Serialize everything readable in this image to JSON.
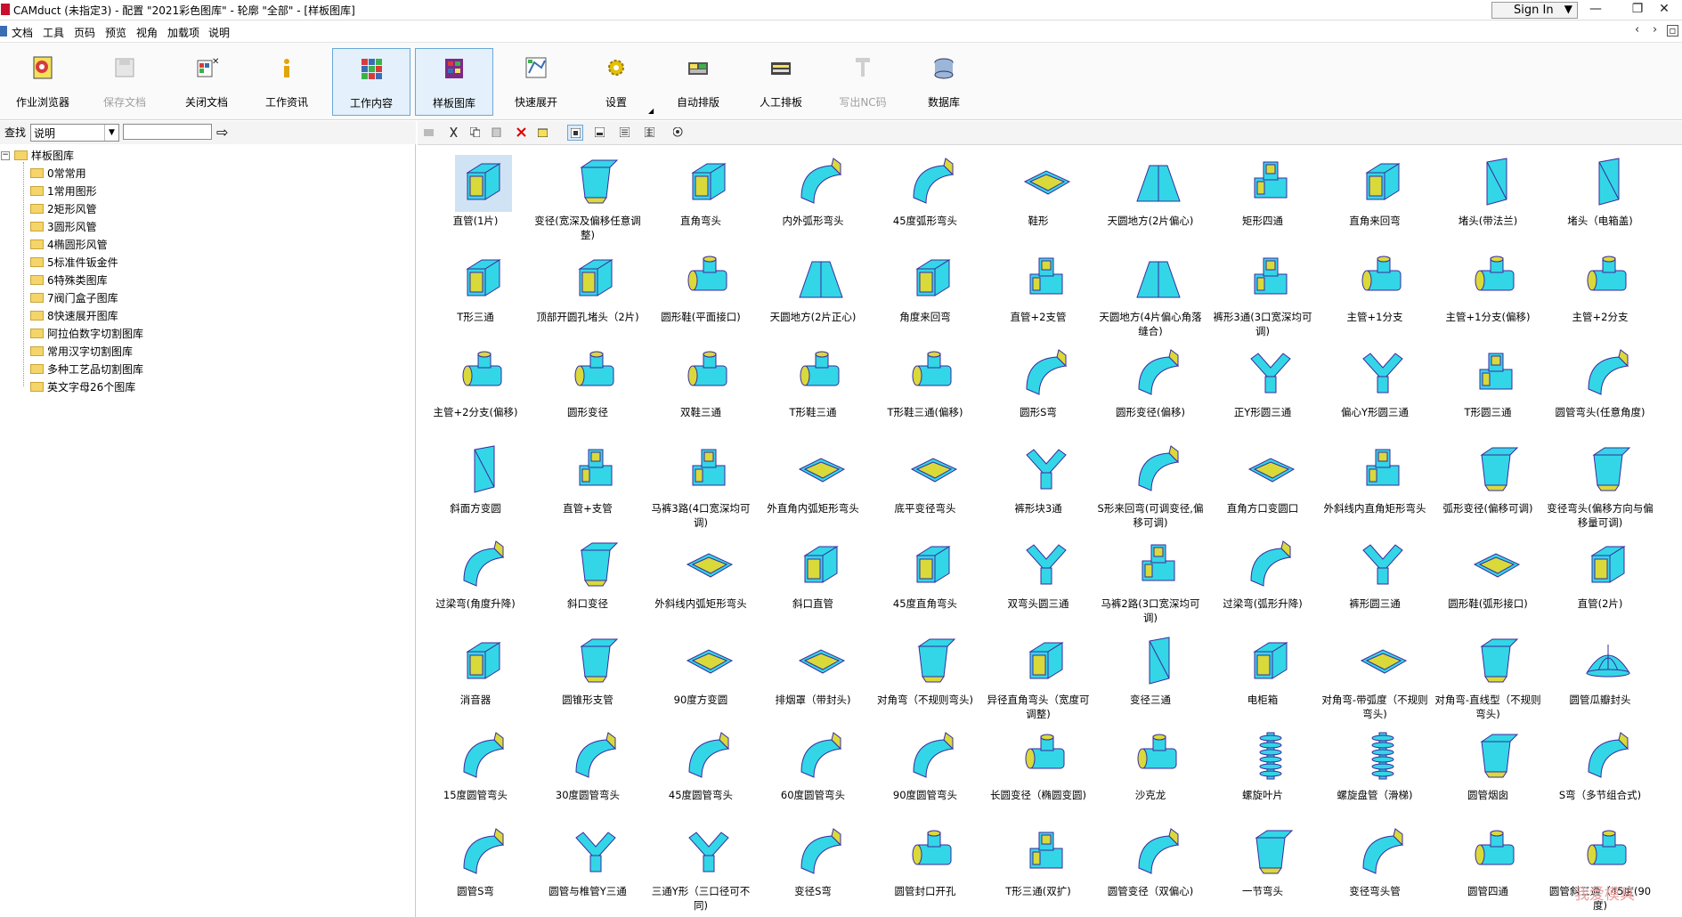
{
  "window": {
    "title": "CAMduct (未指定3) - 配置 \"2021彩色图库\" - 轮廓 \"全部\" - [样板图库]",
    "signin_label": "Sign In",
    "controls": [
      "—",
      "❐",
      "✕"
    ]
  },
  "menu": {
    "items": [
      "文档",
      "工具",
      "页码",
      "预览",
      "视角",
      "加载项",
      "说明"
    ]
  },
  "toolbar": {
    "buttons": [
      {
        "label": "作业浏览器",
        "icon": "job-browser-icon",
        "state": "normal"
      },
      {
        "label": "保存文档",
        "icon": "save-icon",
        "state": "disabled"
      },
      {
        "label": "关闭文档",
        "icon": "close-doc-icon",
        "state": "normal"
      },
      {
        "label": "工作资讯",
        "icon": "info-icon",
        "state": "normal"
      },
      {
        "label": "工作内容",
        "icon": "work-content-icon",
        "state": "active"
      },
      {
        "label": "样板图库",
        "icon": "pattern-library-icon",
        "state": "active"
      },
      {
        "label": "快速展开",
        "icon": "quick-unfold-icon",
        "state": "normal"
      },
      {
        "label": "设置",
        "icon": "settings-icon",
        "state": "normal"
      },
      {
        "label": "自动排版",
        "icon": "auto-nest-icon",
        "state": "normal"
      },
      {
        "label": "人工排板",
        "icon": "manual-nest-icon",
        "state": "normal"
      },
      {
        "label": "写出NC码",
        "icon": "nc-code-icon",
        "state": "disabled"
      },
      {
        "label": "数据库",
        "icon": "database-icon",
        "state": "normal"
      }
    ]
  },
  "find": {
    "label": "查找",
    "field_value": "说明",
    "search_value": ""
  },
  "tree": {
    "root": "样板图库",
    "folders": [
      "0常常用",
      "1常用图形",
      "2矩形风管",
      "3圆形风管",
      "4椭圆形风管",
      "5标准件钣金件",
      "6特殊类图库",
      "7阀门盒子图库",
      "8快速展开图库",
      "阿拉伯数字切割图库",
      "常用汉字切割图库",
      "多种工艺品切割图库",
      "英文字母26个图库"
    ]
  },
  "itembar": {
    "icons": [
      "folder-up-icon",
      "cut-icon",
      "copy-icon",
      "paste-icon",
      "delete-icon",
      "properties-icon",
      "large-icons-view-icon",
      "small-icons-view-icon",
      "list-view-icon",
      "details-view-icon",
      "preview-icon"
    ]
  },
  "items": [
    {
      "label": "直管(1片)",
      "shape": "rect"
    },
    {
      "label": "变径(宽深及偏移任意调整)",
      "shape": "taper"
    },
    {
      "label": "直角弯头",
      "shape": "rect"
    },
    {
      "label": "内外弧形弯头",
      "shape": "elbow"
    },
    {
      "label": "45度弧形弯头",
      "shape": "elbow"
    },
    {
      "label": "鞋形",
      "shape": "flat"
    },
    {
      "label": "天圆地方(2片偏心)",
      "shape": "trap"
    },
    {
      "label": "矩形四通",
      "shape": "cross"
    },
    {
      "label": "直角来回弯",
      "shape": "rect"
    },
    {
      "label": "堵头(带法兰)",
      "shape": "plate"
    },
    {
      "label": "堵头（电箱盖)",
      "shape": "plate"
    },
    {
      "label": "T形三通",
      "shape": "rect"
    },
    {
      "label": "顶部开圆孔堵头（2片)",
      "shape": "rect"
    },
    {
      "label": "圆形鞋(平面接口)",
      "shape": "round"
    },
    {
      "label": "天圆地方(2片正心)",
      "shape": "trap"
    },
    {
      "label": "角度来回弯",
      "shape": "rect"
    },
    {
      "label": "直管+2支管",
      "shape": "cross"
    },
    {
      "label": "天圆地方(4片偏心角落缝合)",
      "shape": "trap"
    },
    {
      "label": "裤形3通(3口宽深均可调)",
      "shape": "cross"
    },
    {
      "label": "主管+1分支",
      "shape": "round"
    },
    {
      "label": "主管+1分支(偏移)",
      "shape": "round"
    },
    {
      "label": "主管+2分支",
      "shape": "round"
    },
    {
      "label": "主管+2分支(偏移)",
      "shape": "round"
    },
    {
      "label": "圆形变径",
      "shape": "round"
    },
    {
      "label": "双鞋三通",
      "shape": "round"
    },
    {
      "label": "T形鞋三通",
      "shape": "round"
    },
    {
      "label": "T形鞋三通(偏移)",
      "shape": "round"
    },
    {
      "label": "圆形S弯",
      "shape": "elbow"
    },
    {
      "label": "圆形变径(偏移)",
      "shape": "elbow"
    },
    {
      "label": "正Y形圆三通",
      "shape": "wye"
    },
    {
      "label": "偏心Y形圆三通",
      "shape": "wye"
    },
    {
      "label": "T形圆三通",
      "shape": "cross"
    },
    {
      "label": "圆管弯头(任意角度)",
      "shape": "elbow"
    },
    {
      "label": "斜面方变圆",
      "shape": "plate"
    },
    {
      "label": "直管+支管",
      "shape": "cross"
    },
    {
      "label": "马裤3路(4口宽深均可调)",
      "shape": "cross"
    },
    {
      "label": "外直角内弧矩形弯头",
      "shape": "flat"
    },
    {
      "label": "底平变径弯头",
      "shape": "flat"
    },
    {
      "label": "裤形块3通",
      "shape": "wye"
    },
    {
      "label": "S形来回弯(可调变径,偏移可调)",
      "shape": "elbow"
    },
    {
      "label": "直角方口变圆口",
      "shape": "flat"
    },
    {
      "label": "外斜线内直角矩形弯头",
      "shape": "cross"
    },
    {
      "label": "弧形变径(偏移可调)",
      "shape": "taper"
    },
    {
      "label": "变径弯头(偏移方向与偏移量可调)",
      "shape": "taper"
    },
    {
      "label": "过梁弯(角度升降)",
      "shape": "elbow"
    },
    {
      "label": "斜口变径",
      "shape": "taper"
    },
    {
      "label": "外斜线内弧矩形弯头",
      "shape": "flat"
    },
    {
      "label": "斜口直管",
      "shape": "rect"
    },
    {
      "label": "45度直角弯头",
      "shape": "rect"
    },
    {
      "label": "双弯头圆三通",
      "shape": "wye"
    },
    {
      "label": "马裤2路(3口宽深均可调)",
      "shape": "cross"
    },
    {
      "label": "过梁弯(弧形升降)",
      "shape": "elbow"
    },
    {
      "label": "裤形圆三通",
      "shape": "wye"
    },
    {
      "label": "圆形鞋(弧形接口)",
      "shape": "flat"
    },
    {
      "label": "直管(2片)",
      "shape": "rect"
    },
    {
      "label": "消音器",
      "shape": "rect"
    },
    {
      "label": "圆锥形支管",
      "shape": "taper"
    },
    {
      "label": "90度方变圆",
      "shape": "flat"
    },
    {
      "label": "排烟罩（带封头)",
      "shape": "flat"
    },
    {
      "label": "对角弯（不规则弯头)",
      "shape": "taper"
    },
    {
      "label": "异径直角弯头（宽度可调整)",
      "shape": "rect"
    },
    {
      "label": "变径三通",
      "shape": "plate"
    },
    {
      "label": "电柜箱",
      "shape": "rect"
    },
    {
      "label": "对角弯-带弧度（不规则弯头)",
      "shape": "flat"
    },
    {
      "label": "对角弯-直线型（不规则弯头)",
      "shape": "taper"
    },
    {
      "label": "圆管瓜瓣封头",
      "shape": "dome"
    },
    {
      "label": "15度圆管弯头",
      "shape": "elbow"
    },
    {
      "label": "30度圆管弯头",
      "shape": "elbow"
    },
    {
      "label": "45度圆管弯头",
      "shape": "elbow"
    },
    {
      "label": "60度圆管弯头",
      "shape": "elbow"
    },
    {
      "label": "90度圆管弯头",
      "shape": "elbow"
    },
    {
      "label": "长圆变径（椭圆变圆)",
      "shape": "round"
    },
    {
      "label": "沙克龙",
      "shape": "round"
    },
    {
      "label": "螺旋叶片",
      "shape": "spiral"
    },
    {
      "label": "螺旋盘管（滑梯)",
      "shape": "spiral"
    },
    {
      "label": "圆管烟囱",
      "shape": "taper"
    },
    {
      "label": "S弯（多节组合式)",
      "shape": "elbow"
    },
    {
      "label": "圆管S弯",
      "shape": "elbow"
    },
    {
      "label": "圆管与椎管Y三通",
      "shape": "wye"
    },
    {
      "label": "三通Y形（三口径可不同)",
      "shape": "wye"
    },
    {
      "label": "变径S弯",
      "shape": "elbow"
    },
    {
      "label": "圆管封口开孔",
      "shape": "round"
    },
    {
      "label": "T形三通(双扩)",
      "shape": "cross"
    },
    {
      "label": "圆管变径（双偏心)",
      "shape": "elbow"
    },
    {
      "label": "一节弯头",
      "shape": "taper"
    },
    {
      "label": "变径弯头管",
      "shape": "elbow"
    },
    {
      "label": "圆管四通",
      "shape": "round"
    },
    {
      "label": "圆管斜三通（45度(90度)",
      "shape": "round"
    }
  ],
  "selected_item_index": 0,
  "watermark": "我爱模具",
  "colors": {
    "duct_fill": "#33d6e6",
    "duct_edge": "#3b2a9e",
    "duct_face": "#d9d93a",
    "selection": "#cfe3f5",
    "active_toolbar": "#e4f0fb"
  }
}
